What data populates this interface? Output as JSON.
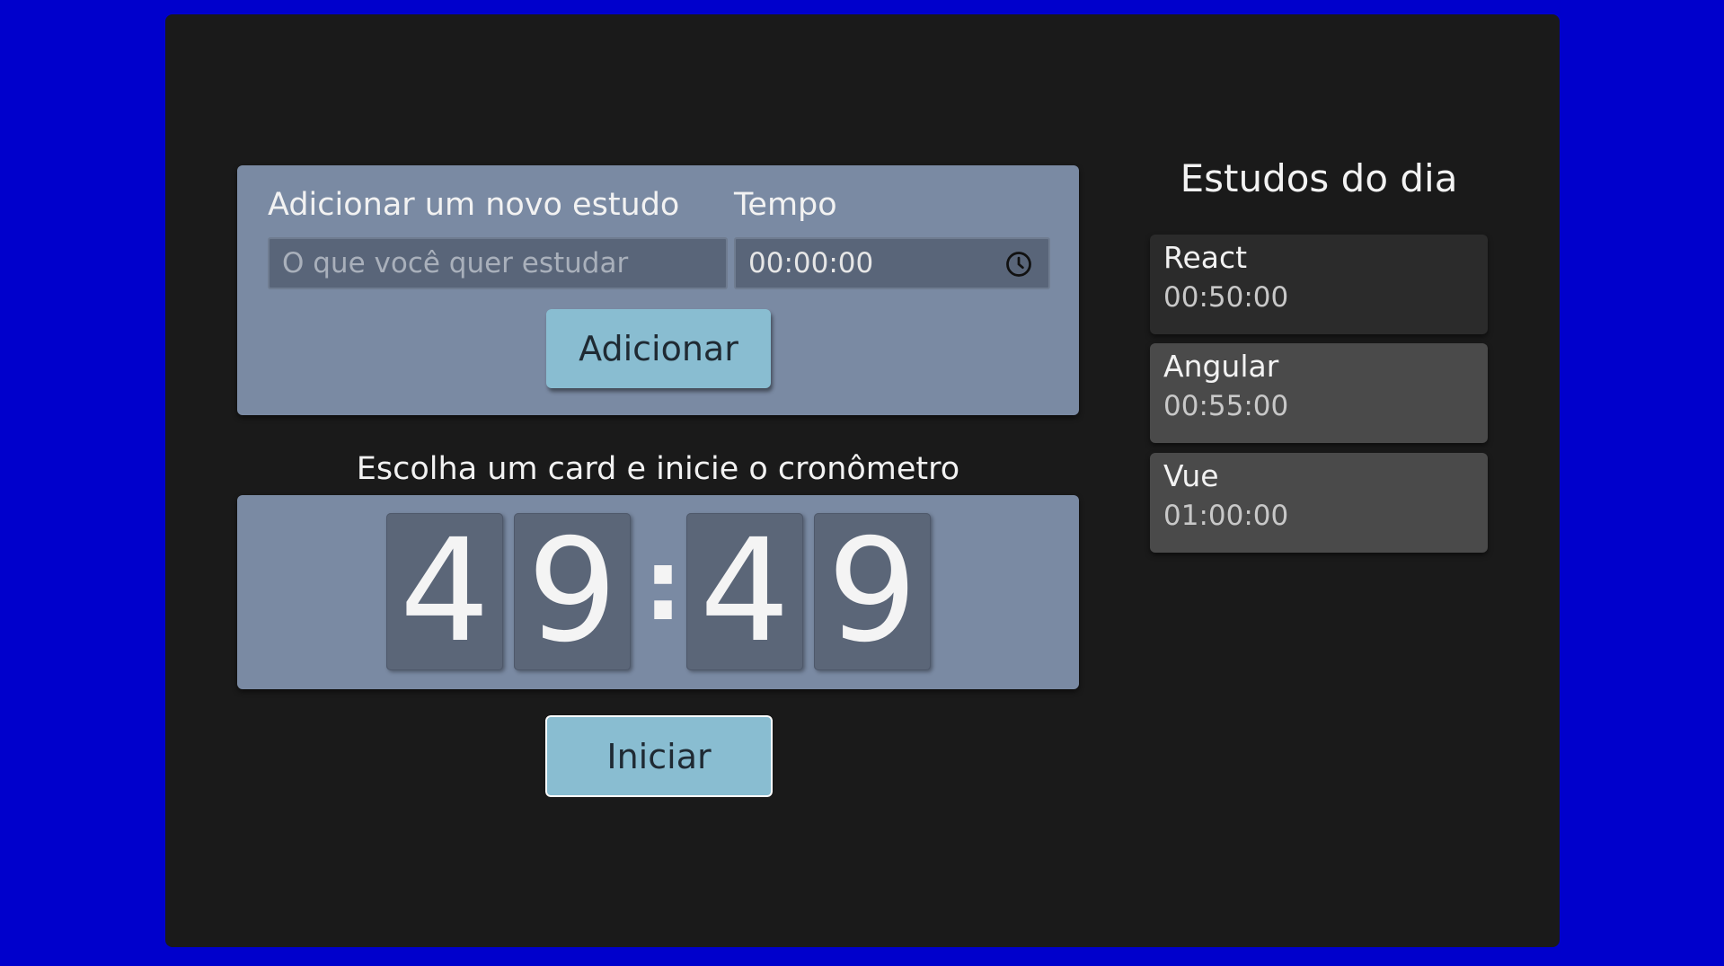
{
  "form": {
    "subject_label": "Adicionar um novo estudo",
    "subject_placeholder": "O que você quer estudar",
    "time_label": "Tempo",
    "time_value": "00:00:00",
    "time_icon": "clock-icon",
    "add_button": "Adicionar"
  },
  "stopwatch": {
    "title": "Escolha um card e inicie o cronômetro",
    "digits": [
      "4",
      "9",
      "4",
      "9"
    ],
    "separator": ":",
    "start_button": "Iniciar"
  },
  "studies": {
    "title": "Estudos do dia",
    "items": [
      {
        "name": "React",
        "time": "00:50:00",
        "selected": true
      },
      {
        "name": "Angular",
        "time": "00:55:00",
        "selected": false
      },
      {
        "name": "Vue",
        "time": "01:00:00",
        "selected": false
      }
    ]
  },
  "colors": {
    "background": "#0000cc",
    "app": "#1a1a1a",
    "panel": "#7a8aa3",
    "button": "#89bdd1",
    "card": "#4a4a4a",
    "card_selected": "#2b2b2b"
  }
}
